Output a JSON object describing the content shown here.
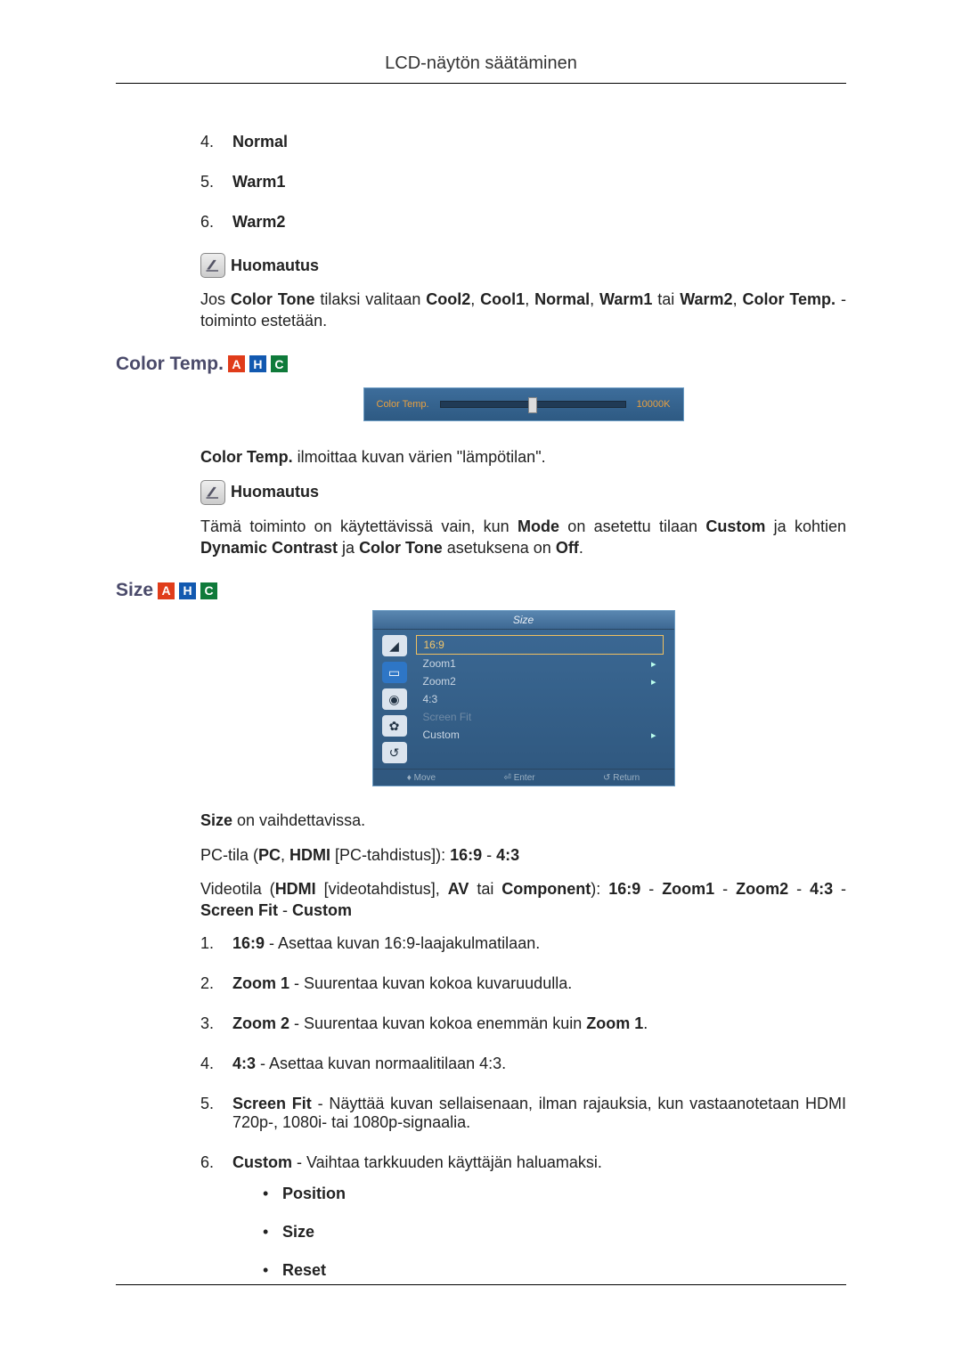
{
  "header": {
    "title": "LCD-näytön säätäminen"
  },
  "list1": {
    "items": [
      {
        "num": "4.",
        "label": "Normal"
      },
      {
        "num": "5.",
        "label": "Warm1"
      },
      {
        "num": "6.",
        "label": "Warm2"
      }
    ]
  },
  "note_label": "Huomautus",
  "para_note1_a": "Jos ",
  "para_note1_b": "Color Tone",
  "para_note1_c": " tilaksi valitaan ",
  "para_note1_d": "Cool2",
  "para_note1_e": ", ",
  "para_note1_f": "Cool1",
  "para_note1_g": ", ",
  "para_note1_h": "Normal",
  "para_note1_i": ", ",
  "para_note1_j": "Warm1",
  "para_note1_k": " tai ",
  "para_note1_l": "Warm2",
  "para_note1_m": ", ",
  "para_note1_n": "Color Temp.",
  "para_note1_o": " -toiminto estetään.",
  "section_colortemp": {
    "title": "Color Temp."
  },
  "slider": {
    "label": "Color Temp.",
    "value": "10000K"
  },
  "para_ct_desc_a": "Color Temp.",
  "para_ct_desc_b": " ilmoittaa kuvan värien \"lämpötilan\".",
  "para_note2_a": "Tämä toiminto on käytettävissä vain, kun ",
  "para_note2_b": "Mode",
  "para_note2_c": " on asetettu tilaan ",
  "para_note2_d": "Custom",
  "para_note2_e": " ja kohtien ",
  "para_note2_f": "Dynamic Contrast",
  "para_note2_g": " ja ",
  "para_note2_h": "Color Tone",
  "para_note2_i": " asetuksena on ",
  "para_note2_j": "Off",
  "para_note2_k": ".",
  "section_size": {
    "title": "Size"
  },
  "osd": {
    "title": "Size",
    "items": [
      {
        "label": "16:9",
        "selected": true,
        "arrow": false,
        "disabled": false
      },
      {
        "label": "Zoom1",
        "selected": false,
        "arrow": true,
        "disabled": false
      },
      {
        "label": "Zoom2",
        "selected": false,
        "arrow": true,
        "disabled": false
      },
      {
        "label": "4:3",
        "selected": false,
        "arrow": false,
        "disabled": false
      },
      {
        "label": "Screen Fit",
        "selected": false,
        "arrow": false,
        "disabled": true
      },
      {
        "label": "Custom",
        "selected": false,
        "arrow": true,
        "disabled": false
      }
    ],
    "footer": {
      "move": "Move",
      "enter": "Enter",
      "return": "Return"
    }
  },
  "size_p1_a": "Size",
  "size_p1_b": " on vaihdettavissa.",
  "size_p2_a": "PC-tila (",
  "size_p2_b": "PC",
  "size_p2_c": ", ",
  "size_p2_d": "HDMI",
  "size_p2_e": " [PC-tahdistus]): ",
  "size_p2_f": "16:9",
  "size_p2_g": " - ",
  "size_p2_h": "4:3",
  "size_p3_a": "Videotila (",
  "size_p3_b": "HDMI",
  "size_p3_c": " [videotahdistus], ",
  "size_p3_d": "AV",
  "size_p3_e": " tai ",
  "size_p3_f": "Component",
  "size_p3_g": "): ",
  "size_p3_h": "16:9",
  "size_p3_i": " - ",
  "size_p3_j": "Zoom1",
  "size_p3_k": " - ",
  "size_p3_l": "Zoom2",
  "size_p3_m": " - ",
  "size_p3_n": "4:3",
  "size_p3_o": " - ",
  "size_p3_p": "Screen Fit",
  "size_p3_q": " - ",
  "size_p3_r": "Custom",
  "size_list": [
    {
      "num": "1.",
      "b": "16:9",
      "t": " - Asettaa kuvan 16:9-laajakulmatilaan."
    },
    {
      "num": "2.",
      "b": "Zoom 1",
      "t": " - Suurentaa kuvan kokoa kuvaruudulla."
    },
    {
      "num": "3.",
      "b": "Zoom 2",
      "t_a": " - Suurentaa kuvan kokoa enemmän kuin ",
      "b2": "Zoom 1",
      "t_b": "."
    },
    {
      "num": "4.",
      "b": "4:3",
      "t": " - Asettaa kuvan normaalitilaan 4:3."
    },
    {
      "num": "5.",
      "b": "Screen Fit",
      "t": " - Näyttää kuvan sellaisenaan, ilman rajauksia, kun vastaanotetaan HDMI 720p-, 1080i- tai 1080p-signaalia."
    },
    {
      "num": "6.",
      "b": "Custom",
      "t": " - Vaihtaa tarkkuuden käyttäjän haluamaksi."
    }
  ],
  "custom_sub": [
    "Position",
    "Size",
    "Reset"
  ],
  "badges": {
    "a": "A",
    "h": "H",
    "c": "C"
  }
}
